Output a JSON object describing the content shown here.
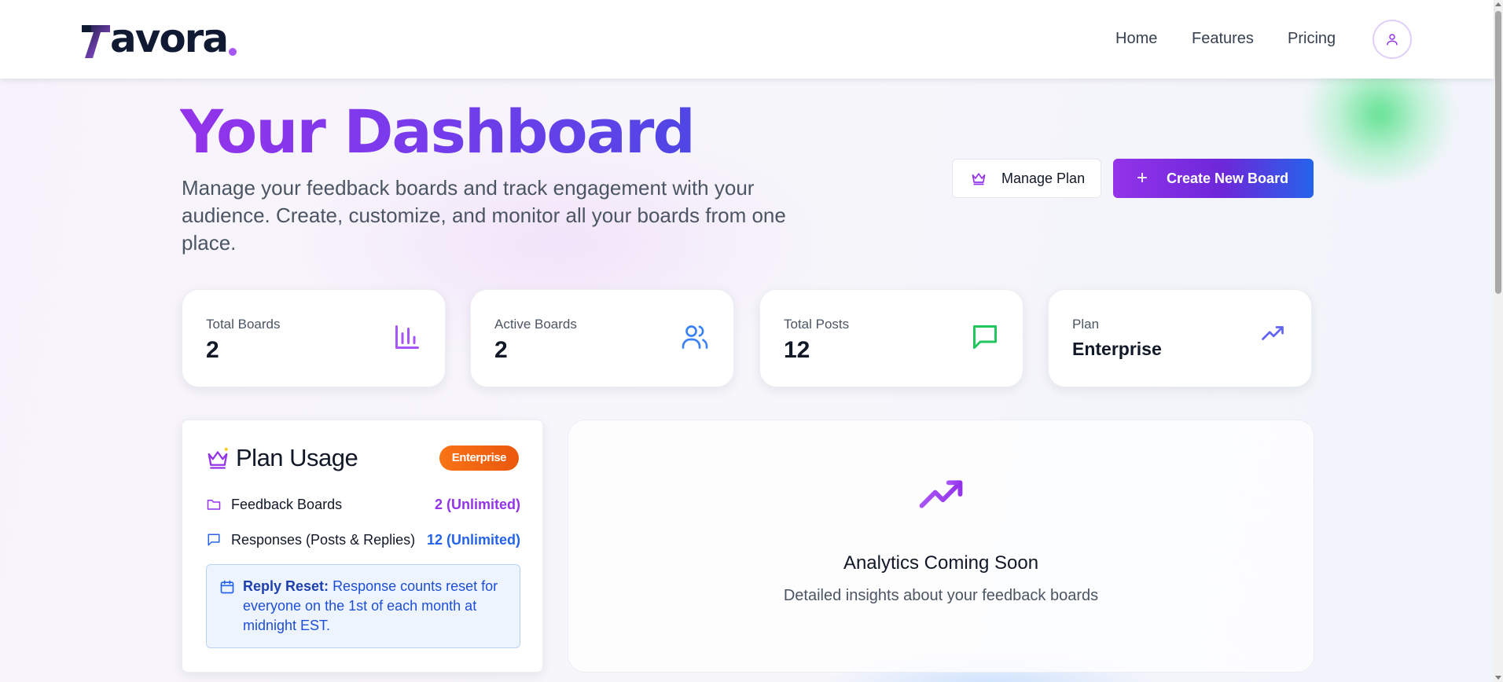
{
  "header": {
    "logo_text": "avora",
    "nav": [
      "Home",
      "Features",
      "Pricing"
    ],
    "avatar_icon": "user-icon"
  },
  "hero": {
    "title": "Your Dashboard",
    "subtitle": "Manage your feedback boards and track engagement with your audience. Create, customize, and monitor all your boards from one place.",
    "manage_plan_label": "Manage Plan",
    "create_board_label": "Create New Board"
  },
  "stats": [
    {
      "label": "Total Boards",
      "value": "2",
      "icon": "bar-chart-icon",
      "color": "#a855f7"
    },
    {
      "label": "Active Boards",
      "value": "2",
      "icon": "users-icon",
      "color": "#3b82f6"
    },
    {
      "label": "Total Posts",
      "value": "12",
      "icon": "message-icon",
      "color": "#22c55e"
    },
    {
      "label": "Plan",
      "value": "Enterprise",
      "icon": "trending-up-icon",
      "color": "#6366f1"
    }
  ],
  "plan_usage": {
    "title": "Plan Usage",
    "badge": "Enterprise",
    "rows": [
      {
        "label": "Feedback Boards",
        "value": "2 (Unlimited)",
        "icon": "folder-icon",
        "color": "#9333ea"
      },
      {
        "label": "Responses (Posts & Replies)",
        "value": "12 (Unlimited)",
        "icon": "message-icon",
        "color": "#2563eb"
      }
    ],
    "reset_bold": "Reply Reset:",
    "reset_text": "Response counts reset for everyone on the 1st of each month at midnight EST."
  },
  "analytics": {
    "title": "Analytics Coming Soon",
    "subtitle": "Detailed insights about your feedback boards"
  },
  "colors": {
    "accent_purple": "#9333ea",
    "accent_blue": "#2563eb",
    "badge_orange": "#f97316"
  }
}
